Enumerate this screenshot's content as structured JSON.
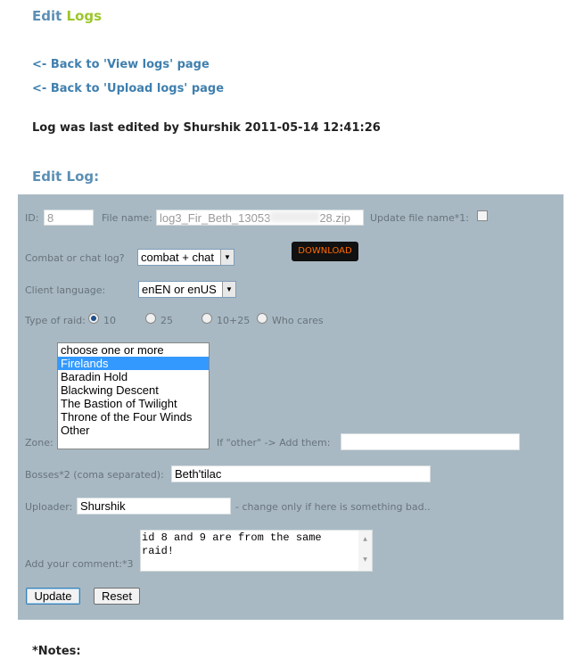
{
  "header": {
    "title_part1": "Edit",
    "title_part2": "Logs"
  },
  "links": {
    "view_logs": "<- Back to 'View logs' page",
    "upload_logs": "<- Back to 'Upload logs' page"
  },
  "last_edited": "Log was last edited by Shurshik 2011-05-14 12:41:26",
  "section_title": "Edit Log:",
  "form": {
    "id_label": "ID:",
    "id_value": "8",
    "filename_label": "File name:",
    "filename_start": "log3_Fir_Beth_13053",
    "filename_end": "28.zip",
    "update_filename_label": "Update file name*1:",
    "download_label": "DOWNLOAD",
    "logtype_label": "Combat or chat log?",
    "logtype_value": "combat + chat",
    "language_label": "Client language:",
    "language_value": "enEN or enUS",
    "raid_label": "Type of raid:",
    "raid_options": [
      "10",
      "25",
      "10+25",
      "Who cares"
    ],
    "raid_selected": "10",
    "zone_label": "Zone:",
    "zone_options": [
      "choose one or more",
      "Firelands",
      "Baradin Hold",
      "Blackwing Descent",
      "The Bastion of Twilight",
      "Throne of the Four Winds",
      "Other"
    ],
    "zone_selected": "Firelands",
    "other_label": "If \"other\" -> Add them:",
    "other_value": "",
    "bosses_label": "Bosses*2 (coma separated):",
    "bosses_value": "Beth'tilac",
    "uploader_label": "Uploader:",
    "uploader_value": "Shurshik",
    "uploader_note": "- change only if here is something bad..",
    "comment_label": "Add your comment:*3",
    "comment_value": "id 8 and 9 are from the same raid!",
    "update_button": "Update",
    "reset_button": "Reset"
  },
  "notes_title": "*Notes:",
  "colors": {
    "panel": "#a8b9c3",
    "title_blue": "#5b8fb5",
    "title_green": "#9cc62b",
    "download_text": "#ff6a00"
  }
}
